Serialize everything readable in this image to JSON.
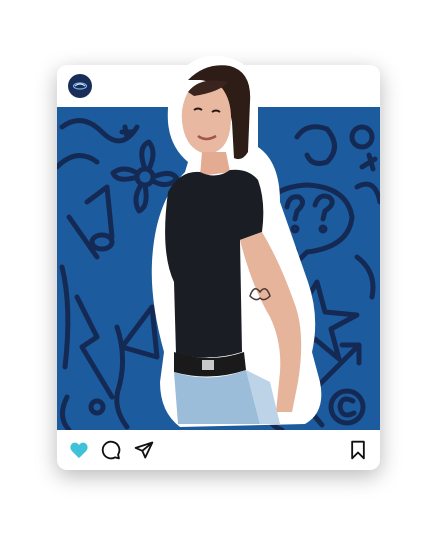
{
  "post": {
    "account_avatar": "brand-logo-icon",
    "colors": {
      "photo_background": "#1c5c9e",
      "doodle_ink": "#142a55",
      "like_active": "#3fc1d9",
      "card": "#ffffff"
    },
    "actions": {
      "like": {
        "icon": "heart-icon",
        "state": "liked"
      },
      "comment": {
        "icon": "comment-icon"
      },
      "share": {
        "icon": "send-icon"
      },
      "save": {
        "icon": "bookmark-icon"
      }
    }
  }
}
